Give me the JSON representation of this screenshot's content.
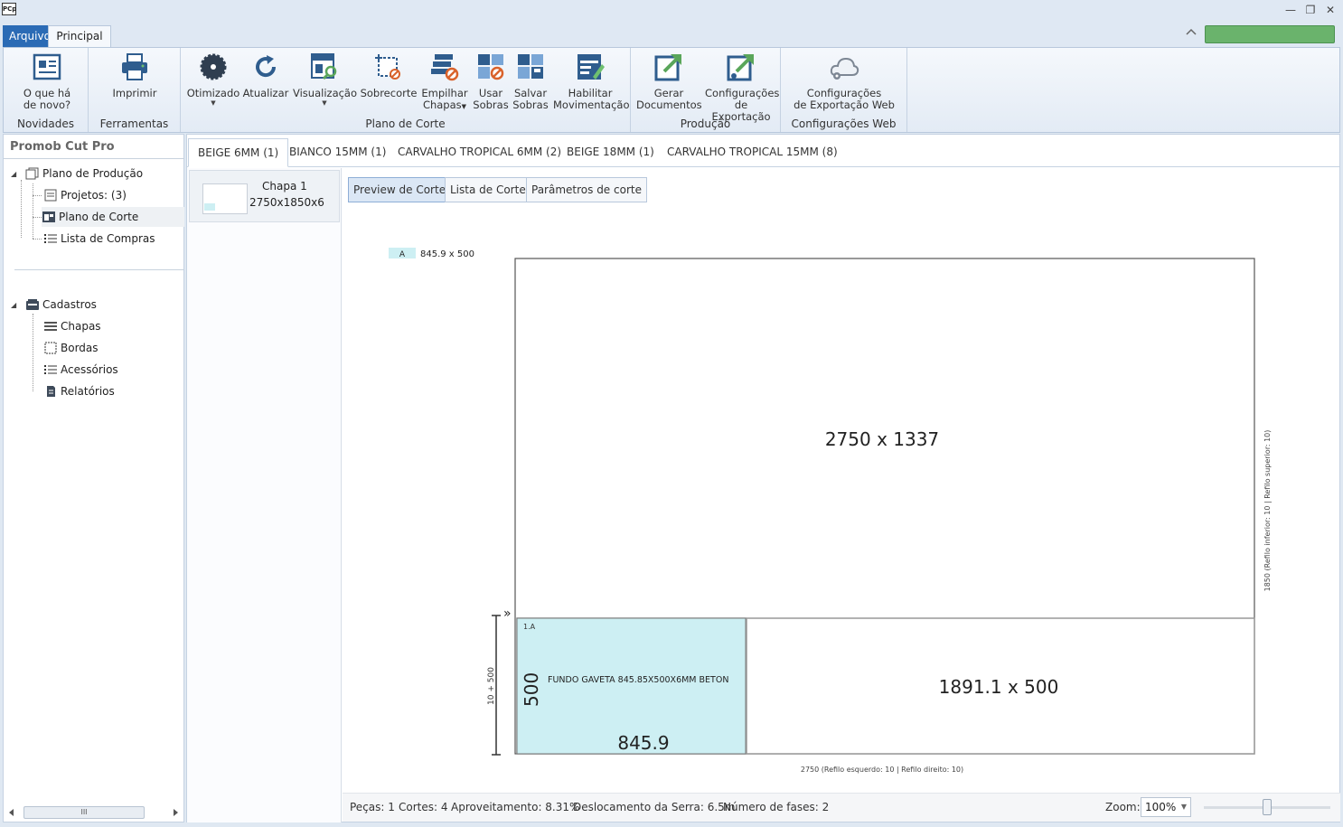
{
  "window": {
    "logo_text": "PCp",
    "minimize_glyph": "—",
    "restore_glyph": "❐",
    "close_glyph": "✕"
  },
  "ribbon_tabs": {
    "file": "Arquivo",
    "main": "Principal"
  },
  "ribbon": {
    "groups": {
      "novidades": "Novidades",
      "ferramentas": "Ferramentas",
      "plano": "Plano de Corte",
      "producao": "Produção",
      "web": "Configurações Web"
    },
    "buttons": {
      "whats_new": [
        "O que há",
        "de novo?"
      ],
      "print": "Imprimir",
      "optimized": "Otimizado",
      "refresh": "Atualizar",
      "view": "Visualização",
      "recut": "Sobrecorte",
      "stack": [
        "Empilhar",
        "Chapas"
      ],
      "use_leftovers": [
        "Usar",
        "Sobras"
      ],
      "save_leftovers": [
        "Salvar",
        "Sobras"
      ],
      "enable_movement": [
        "Habilitar",
        "Movimentação"
      ],
      "generate_docs": [
        "Gerar",
        "Documentos"
      ],
      "export_settings": [
        "Configurações",
        "de Exportação"
      ],
      "web_export_settings": [
        "Configurações",
        "de Exportação Web"
      ]
    }
  },
  "sidebar": {
    "title": "Promob Cut Pro",
    "plan_root": "Plano de Produção",
    "projects": "Projetos: (3)",
    "cut_plan": "Plano de Corte",
    "shopping_list": "Lista de Compras",
    "registry_root": "Cadastros",
    "sheets": "Chapas",
    "edges": "Bordas",
    "accessories": "Acessórios",
    "reports": "Relatórios",
    "scroll_thumb": "III"
  },
  "material_tabs": [
    "BEIGE 6MM (1)",
    "BIANCO 15MM (1)",
    "CARVALHO TROPICAL 6MM (2)",
    "BEIGE  18MM (1)",
    "CARVALHO TROPICAL 15MM (8)"
  ],
  "sheet_card": {
    "name": "Chapa 1",
    "size": "2750x1850x6"
  },
  "view_buttons": {
    "preview": "Preview de Corte",
    "cut_list": "Lista de Corte",
    "cut_params": "Parâmetros de corte"
  },
  "cut_preview": {
    "legend_tag": "A",
    "legend_size": "845.9 x 500",
    "top_leftover": "2750 x 1337",
    "right_leftover": "1891.1 x 500",
    "piece_id": "1.A",
    "piece_name": "FUNDO GAVETA 845.85X500X6MM BETON",
    "piece_height": "500",
    "piece_width": "845.9",
    "strip_dim": "10 + 500",
    "bottom_dim": "2750 (Refilo esquerdo: 10  | Refilo direito: 10)",
    "right_dim": "1850 (Refilo inferior: 10  | Refilo superior: 10)",
    "strip_marker": "»",
    "piece_color": "#cdeff3"
  },
  "status": {
    "pieces": "Peças: 1",
    "cuts": "Cortes: 4",
    "yield": "Aproveitamento: 8.31%",
    "saw_travel": "Deslocamento da Serra: 6.5m",
    "phases": "Número de fases: 2",
    "zoom_label": "Zoom:",
    "zoom_value": "100%",
    "zoom_level_pct": 50
  }
}
